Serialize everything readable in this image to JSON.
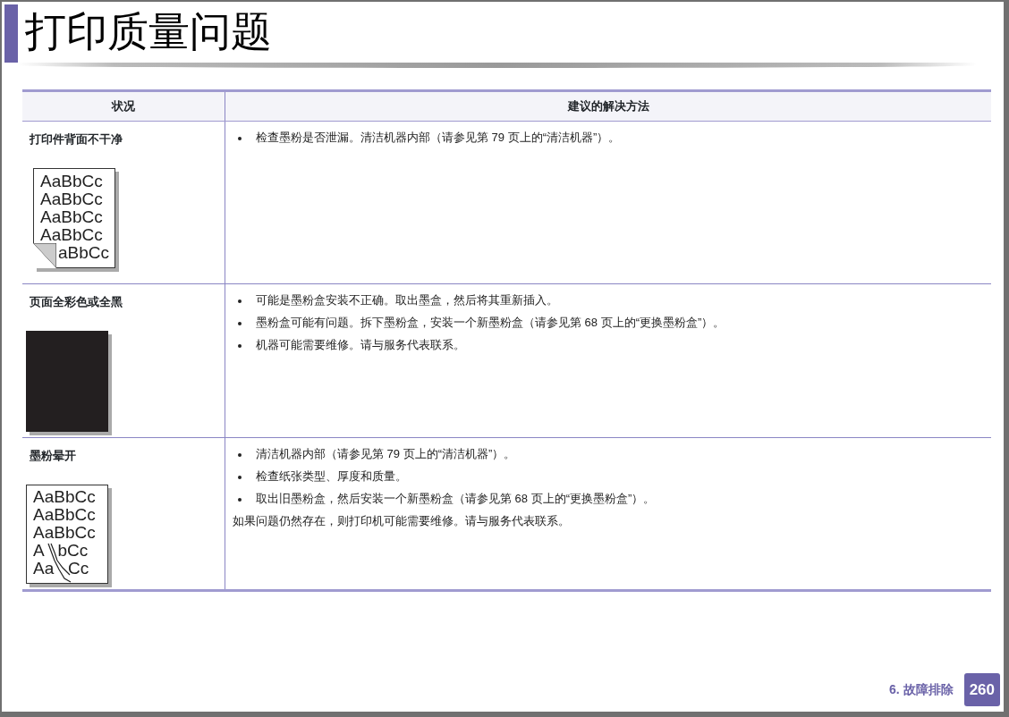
{
  "title": "打印质量问题",
  "table": {
    "columns": [
      "状况",
      "建议的解决方法"
    ],
    "rows": [
      {
        "condition": "打印件背面不干净",
        "illustration": {
          "kind": "folded_page",
          "lines": [
            "AaBbCc",
            "AaBbCc",
            "AaBbCc",
            "AaBbCc",
            "aBbCc"
          ]
        },
        "solutions": [
          {
            "kind": "bullet",
            "text": "检查墨粉是否泄漏。清洁机器内部（请参见第 79 页上的“清洁机器”）。"
          }
        ]
      },
      {
        "condition": "页面全彩色或全黑",
        "illustration": {
          "kind": "black_page"
        },
        "solutions": [
          {
            "kind": "bullet",
            "text": "可能是墨粉盒安装不正确。取出墨盒，然后将其重新插入。"
          },
          {
            "kind": "bullet",
            "text": "墨粉盒可能有问题。拆下墨粉盒，安装一个新墨粉盒（请参见第 68 页上的“更换墨粉盒”）。"
          },
          {
            "kind": "bullet",
            "text": "机器可能需要维修。请与服务代表联系。"
          }
        ]
      },
      {
        "condition": "墨粉晕开",
        "illustration": {
          "kind": "smeared_page",
          "lines": [
            "AaBbCc",
            "AaBbCc",
            "AaBbCc",
            "A   bCc",
            "Aa   Cc"
          ]
        },
        "solutions": [
          {
            "kind": "bullet",
            "text": "清洁机器内部（请参见第 79 页上的“清洁机器”）。"
          },
          {
            "kind": "bullet",
            "text": "检查纸张类型、厚度和质量。"
          },
          {
            "kind": "bullet",
            "text": "取出旧墨粉盒，然后安装一个新墨粉盒（请参见第 68 页上的“更换墨粉盒”）。"
          },
          {
            "kind": "note",
            "text": "如果问题仍然存在，则打印机可能需要维修。请与服务代表联系。"
          }
        ]
      }
    ]
  },
  "footer": {
    "chapter": "6. 故障排除",
    "page": "260"
  }
}
